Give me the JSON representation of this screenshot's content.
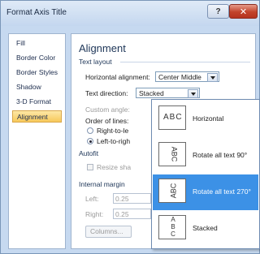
{
  "window": {
    "title": "Format Axis Title",
    "help_glyph": "?",
    "close_glyph": "✕"
  },
  "nav": {
    "items": [
      "Fill",
      "Border Color",
      "Border Styles",
      "Shadow",
      "3-D Format",
      "Alignment"
    ],
    "selected": "Alignment"
  },
  "alignment": {
    "heading": "Alignment",
    "text_layout": "Text layout",
    "horizontal_label": "Horizontal alignment:",
    "horizontal_value": "Center Middle",
    "direction_label": "Text direction:",
    "direction_value": "Stacked",
    "custom_angle_label": "Custom angle:",
    "order_label": "Order of lines:",
    "right_to_left": "Right-to-le",
    "left_to_right": "Left-to-righ",
    "autofit": "Autofit",
    "resize_shape": "Resize sha",
    "internal_margin": "Internal margin",
    "left_label": "Left:",
    "left_value": "0.25",
    "right_label": "Right:",
    "right_value": "0.25",
    "columns_button": "Columns..."
  },
  "dropdown": {
    "options": [
      {
        "icon_text": "ABC",
        "label": "Horizontal"
      },
      {
        "icon_text": "ABC",
        "label": "Rotate all text 90°"
      },
      {
        "icon_text": "ABC",
        "label": "Rotate all text 270°"
      },
      {
        "icon_text": "A B C",
        "label": "Stacked"
      }
    ],
    "highlighted": "Rotate all text 270°"
  },
  "colors": {
    "accent": "#3c91e6",
    "selected_nav": "#f7c95a",
    "close_button": "#c2432b"
  }
}
